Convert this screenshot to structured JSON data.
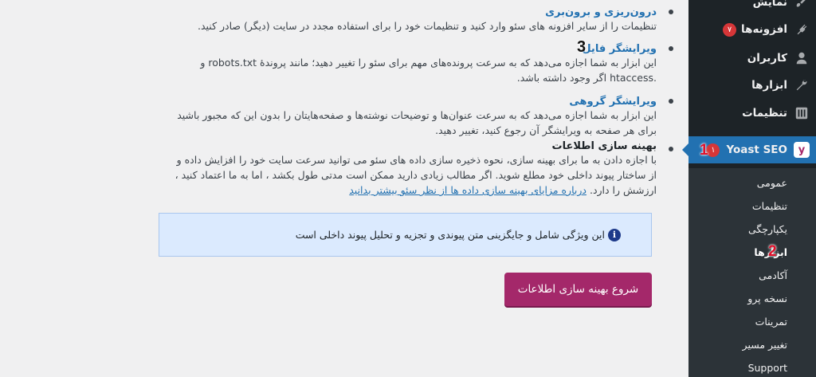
{
  "sections": [
    {
      "title": "درون‌ریزی و برون‌بری",
      "lines": [
        "تنظیمات را از سایر افزونه های سئو وارد کنید و تنظیمات خود را برای استفاده مجدد در سایت (دیگر) صادر کنید."
      ]
    },
    {
      "title": "ویرایشگر فایل",
      "lines": [
        "این ابزار به شما اجازه می‌دهد که به سرعت پرونده‌های مهم برای سئو را تغییر دهید؛ مانند پروندهٔ robots.txt و",
        ".htaccess اگر وجود داشته باشد."
      ]
    },
    {
      "title": "ویرایشگر گروهی",
      "lines": [
        "این ابزار به شما اجازه می‌دهد که به سرعت عنوان‌ها و توضیحات نوشته‌ها و صفحه‌هایتان را بدون این که مجبور باشید",
        "برای هر صفحه به ویرایشگر آن رجوع کنید، تغییر دهید."
      ]
    },
    {
      "title": "بهینه سازی اطلاعات",
      "lines": [
        "با اجازه دادن به ما برای بهینه سازی، نحوه ذخیره سازی داده های سئو می توانید سرعت سایت خود را افزایش داده و",
        "از ساختار پیوند داخلی خود مطلع شوید. اگر مطالب زیادی دارید ممکن است مدتی طول بکشد ، اما به ما اعتماد کنید ،",
        "ارزشش را دارد."
      ],
      "link": "درباره مزایای بهینه سازی داده ها از نظر سئو بیشتر بدانید"
    }
  ],
  "notice": {
    "text": "این ویژگی شامل و جایگزینی متن پیوندی و تجزیه و تحلیل پیوند داخلی است",
    "icon": "info-icon"
  },
  "start_button": "شروع بهینه سازی اطلاعات",
  "sidebar": {
    "items": [
      {
        "label": "نمایش",
        "icon": "appearance-icon"
      },
      {
        "label": "افزونه‌ها",
        "icon": "plugin-icon",
        "badge": "۷"
      },
      {
        "label": "کاربران",
        "icon": "users-icon"
      },
      {
        "label": "ابزارها",
        "icon": "tools-icon"
      },
      {
        "label": "تنظیمات",
        "icon": "settings-icon"
      },
      {
        "label": "Yoast SEO",
        "icon": "yoast-icon",
        "badge": "۱"
      }
    ],
    "submenu": [
      "عمومی",
      "تنظیمات",
      "یکپارچگی",
      "ابزارها",
      "آکادمی",
      "نسخه پرو",
      "تمرینات",
      "تغییر مسیر",
      "Support"
    ]
  },
  "annotations": [
    "1",
    "2",
    "3"
  ],
  "colors": {
    "sidebar_bg": "#1d2327",
    "submenu_bg": "#2c3338",
    "active_bg": "#2271b1",
    "button_bg": "#a4286a",
    "notice_bg": "#dbeafe",
    "badge_bg": "#d63638",
    "link": "#2271b1"
  }
}
